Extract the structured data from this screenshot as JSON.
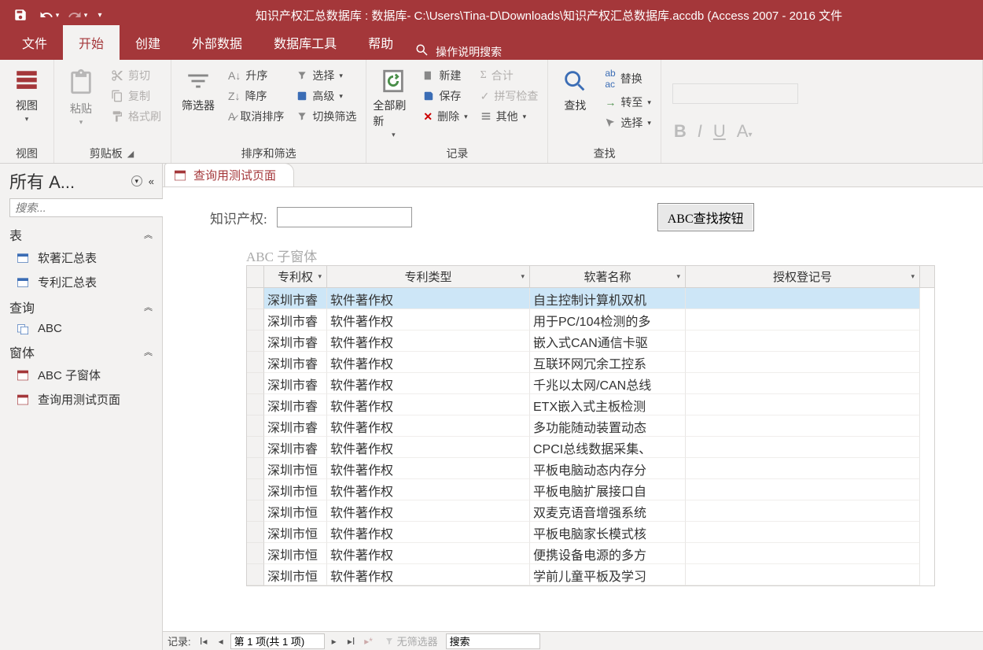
{
  "titleBar": {
    "title": "知识产权汇总数据库 : 数据库- C:\\Users\\Tina-D\\Downloads\\知识产权汇总数据库.accdb (Access 2007 - 2016 文件"
  },
  "ribbonTabs": {
    "file": "文件",
    "home": "开始",
    "create": "创建",
    "external": "外部数据",
    "dbtools": "数据库工具",
    "help": "帮助",
    "tellme": "操作说明搜索"
  },
  "ribbon": {
    "view": {
      "btn": "视图",
      "group": "视图"
    },
    "clipboard": {
      "paste": "粘贴",
      "cut": "剪切",
      "copy": "复制",
      "formatPainter": "格式刷",
      "group": "剪贴板"
    },
    "sortFilter": {
      "filter": "筛选器",
      "asc": "升序",
      "desc": "降序",
      "clear": "取消排序",
      "selection": "选择",
      "advanced": "高级",
      "toggle": "切换筛选",
      "group": "排序和筛选"
    },
    "records": {
      "refreshAll": "全部刷新",
      "new": "新建",
      "save": "保存",
      "delete": "删除",
      "totals": "合计",
      "spelling": "拼写检查",
      "more": "其他",
      "group": "记录"
    },
    "find": {
      "find": "查找",
      "replace": "替换",
      "goto": "转至",
      "select": "选择",
      "group": "查找"
    }
  },
  "nav": {
    "header": "所有 A...",
    "searchPlaceholder": "搜索...",
    "sections": {
      "tables": "表",
      "queries": "查询",
      "forms": "窗体"
    },
    "items": {
      "table1": "软著汇总表",
      "table2": "专利汇总表",
      "query1": "ABC",
      "form1": "ABC 子窗体",
      "form2": "查询用测试页面"
    }
  },
  "docTab": "查询用测试页面",
  "form": {
    "fieldLabel": "知识产权:",
    "searchButton": "ABC查找按钮",
    "subformLabel": "ABC 子窗体"
  },
  "datasheet": {
    "headers": {
      "c1": "专利权",
      "c2": "专利类型",
      "c3": "软著名称",
      "c4": "授权登记号"
    },
    "rows": [
      {
        "c1": "深圳市睿",
        "c2": "软件著作权",
        "c3": "自主控制计算机双机",
        "c4": ""
      },
      {
        "c1": "深圳市睿",
        "c2": "软件著作权",
        "c3": "用于PC/104检测的多",
        "c4": ""
      },
      {
        "c1": "深圳市睿",
        "c2": "软件著作权",
        "c3": "嵌入式CAN通信卡驱",
        "c4": ""
      },
      {
        "c1": "深圳市睿",
        "c2": "软件著作权",
        "c3": "互联环网冗余工控系",
        "c4": ""
      },
      {
        "c1": "深圳市睿",
        "c2": "软件著作权",
        "c3": "千兆以太网/CAN总线",
        "c4": ""
      },
      {
        "c1": "深圳市睿",
        "c2": "软件著作权",
        "c3": "ETX嵌入式主板检测",
        "c4": ""
      },
      {
        "c1": "深圳市睿",
        "c2": "软件著作权",
        "c3": "多功能随动装置动态",
        "c4": ""
      },
      {
        "c1": "深圳市睿",
        "c2": "软件著作权",
        "c3": "CPCI总线数据采集、",
        "c4": ""
      },
      {
        "c1": "深圳市恒",
        "c2": "软件著作权",
        "c3": "平板电脑动态内存分",
        "c4": ""
      },
      {
        "c1": "深圳市恒",
        "c2": "软件著作权",
        "c3": "平板电脑扩展接口自",
        "c4": ""
      },
      {
        "c1": "深圳市恒",
        "c2": "软件著作权",
        "c3": "双麦克语音增强系统",
        "c4": ""
      },
      {
        "c1": "深圳市恒",
        "c2": "软件著作权",
        "c3": "平板电脑家长模式核",
        "c4": ""
      },
      {
        "c1": "深圳市恒",
        "c2": "软件著作权",
        "c3": "便携设备电源的多方",
        "c4": ""
      },
      {
        "c1": "深圳市恒",
        "c2": "软件著作权",
        "c3": "学前儿童平板及学习",
        "c4": ""
      }
    ]
  },
  "recordNav": {
    "label": "记录:",
    "position": "第 1 项(共 1 项)",
    "noFilter": "无筛选器",
    "search": "搜索"
  }
}
